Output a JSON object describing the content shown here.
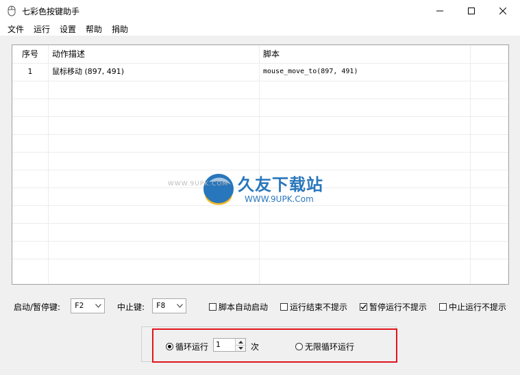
{
  "window": {
    "title": "七彩色按键助手"
  },
  "menu": [
    "文件",
    "运行",
    "设置",
    "帮助",
    "捐助"
  ],
  "table": {
    "headers": [
      "序号",
      "动作描述",
      "脚本"
    ],
    "rows": [
      {
        "index": "1",
        "description": "鼠标移动 (897, 491)",
        "script": "mouse_move_to(897, 491)"
      }
    ]
  },
  "watermark": {
    "brand": "久友下载站",
    "url_small": "WWW.9UPK.COM",
    "url": "WWW.9UPK.Com"
  },
  "hotkeys": {
    "start_pause_label": "启动/暂停键:",
    "start_pause_value": "F2",
    "stop_label": "中止键:",
    "stop_value": "F8"
  },
  "options": [
    {
      "label": "脚本自动启动",
      "checked": false
    },
    {
      "label": "运行结束不提示",
      "checked": false
    },
    {
      "label": "暂停运行不提示",
      "checked": true
    },
    {
      "label": "中止运行不提示",
      "checked": false
    }
  ],
  "loop": {
    "loop_label": "循环运行",
    "count": "1",
    "times_unit": "次",
    "infinite_label": "无限循环运行",
    "selected": "loop"
  }
}
